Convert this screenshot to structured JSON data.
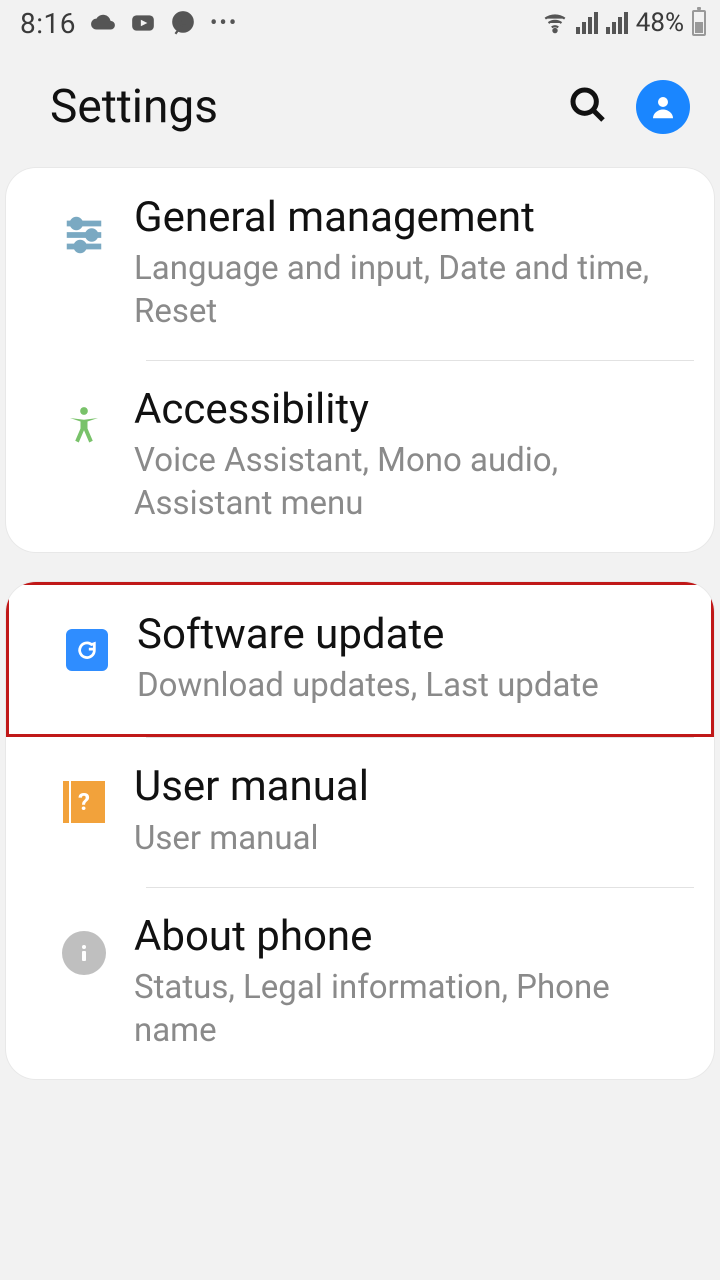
{
  "status": {
    "time": "8:16",
    "battery_text": "48%",
    "icons_left": [
      "cloud",
      "youtube",
      "whatsapp",
      "more"
    ],
    "icons_right": [
      "wifi",
      "signal1",
      "signal2",
      "battery"
    ]
  },
  "header": {
    "title": "Settings"
  },
  "groups": [
    {
      "items": [
        {
          "icon": "sliders-icon",
          "title": "General management",
          "subtitle": "Language and input, Date and time, Reset",
          "highlight": false
        },
        {
          "icon": "accessibility-icon",
          "title": "Accessibility",
          "subtitle": "Voice Assistant, Mono audio, Assistant menu",
          "highlight": false
        }
      ]
    },
    {
      "items": [
        {
          "icon": "update-icon",
          "title": "Software update",
          "subtitle": "Download updates, Last update",
          "highlight": true
        },
        {
          "icon": "manual-icon",
          "title": "User manual",
          "subtitle": "User manual",
          "highlight": false
        },
        {
          "icon": "info-icon",
          "title": "About phone",
          "subtitle": "Status, Legal information, Phone name",
          "highlight": false
        }
      ]
    }
  ]
}
